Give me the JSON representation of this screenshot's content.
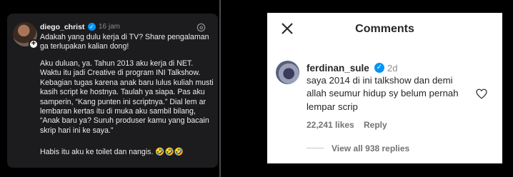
{
  "left_post": {
    "username": "diego_christ",
    "verified_glyph": "✓",
    "time": "16 jam",
    "plus_glyph": "+",
    "paragraph1": "Adakah yang dulu kerja di TV? Share pengalaman\nga terlupakan kalian dong!",
    "paragraph2": "Aku duluan, ya. Tahun 2013 aku kerja di NET.\nWaktu itu jadi Creative di program INI Talkshow.\nKebagian tugas karena anak baru lulus kuliah musti\nkasih script ke hostnya. Taulah ya siapa. Pas aku\nsamperin, “Kang punten ini scriptnya.” Dial lem  ar\nlembaran kertas itu di muka aku sambil bilang,\n“Anak baru ya? Suruh produser kamu yang bacain\nskrip hari ini ke saya.”",
    "paragraph3": "Habis itu aku ke toilet dan nangis. 🤣🤣🤣",
    "icons": [
      "avatar",
      "verified-badge-icon",
      "threads-icon"
    ]
  },
  "comments_panel": {
    "title": "Comments",
    "close_icon": "close-icon",
    "comment": {
      "username": "ferdinan_sule",
      "verified_glyph": "✓",
      "time": "2d",
      "text": "saya 2014 di ini talkshow dan demi\nallah seumur hidup sy belum pernah\nlempar scrip",
      "likes": "22,241 likes",
      "reply_label": "Reply",
      "view_replies": "View all 938 replies",
      "like_icon": "heart-icon"
    }
  },
  "colors": {
    "post_bg": "#1c1c1e",
    "verified_blue": "#0095f6",
    "panel_bg": "#ffffff",
    "muted_text": "#737373"
  }
}
